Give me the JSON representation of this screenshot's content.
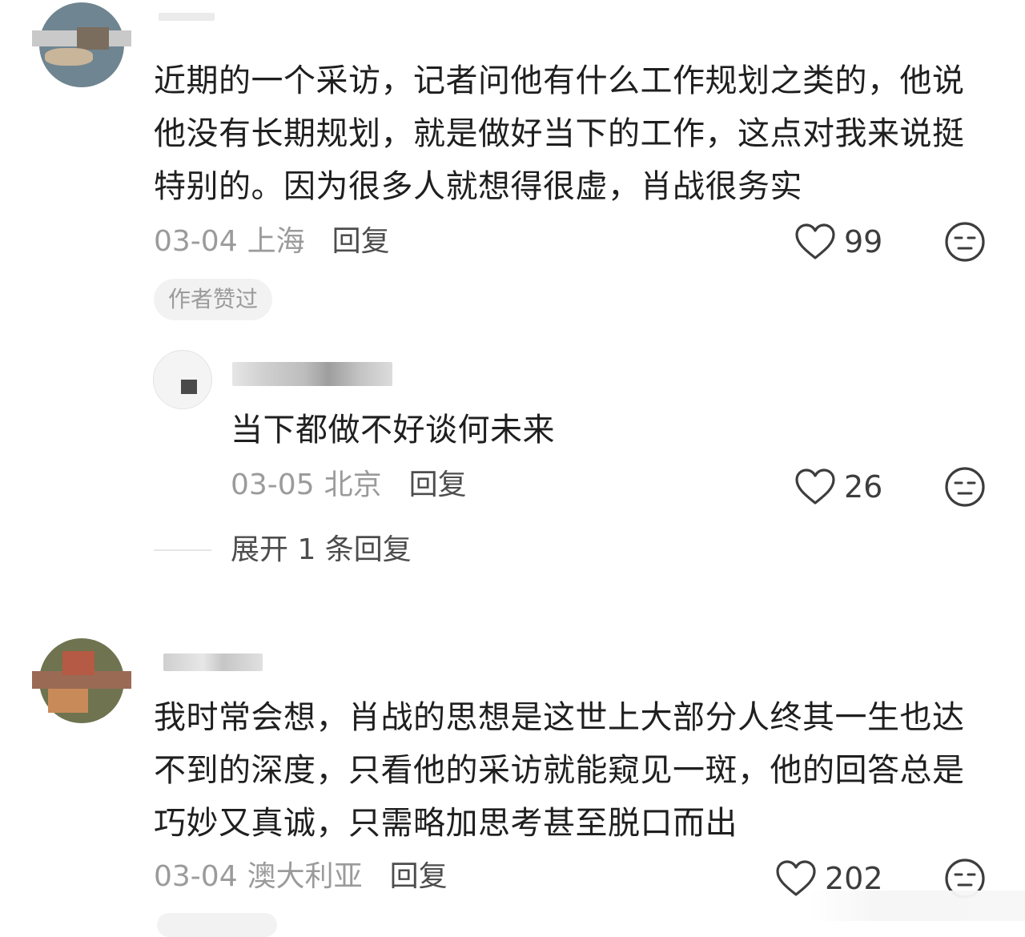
{
  "comments": [
    {
      "text": "近期的一个采访，记者问他有什么工作规划之类的，他说他没有长期规划，就是做好当下的工作，这点对我来说挺特别的。因为很多人就想得很虚，肖战很务实",
      "date": "03-04",
      "location": "上海",
      "reply_label": "回复",
      "likes": "99",
      "badge": "作者赞过",
      "replies": [
        {
          "text": "当下都做不好谈何未来",
          "date": "03-05",
          "location": "北京",
          "reply_label": "回复",
          "likes": "26"
        }
      ],
      "expand_label": "展开 1 条回复"
    },
    {
      "text": "我时常会想，肖战的思想是这世上大部分人终其一生也达不到的深度，只看他的采访就能窥见一斑，他的回答总是巧妙又真诚，只需略加思考甚至脱口而出",
      "date": "03-04",
      "location": "澳大利亚",
      "reply_label": "回复",
      "likes": "202"
    }
  ],
  "icons": {
    "like": "heart-outline-icon",
    "dislike": "unamused-face-icon"
  },
  "colors": {
    "text": "#1f1f1f",
    "meta": "#9b9b9b",
    "badge_bg": "#f2f2f2"
  }
}
